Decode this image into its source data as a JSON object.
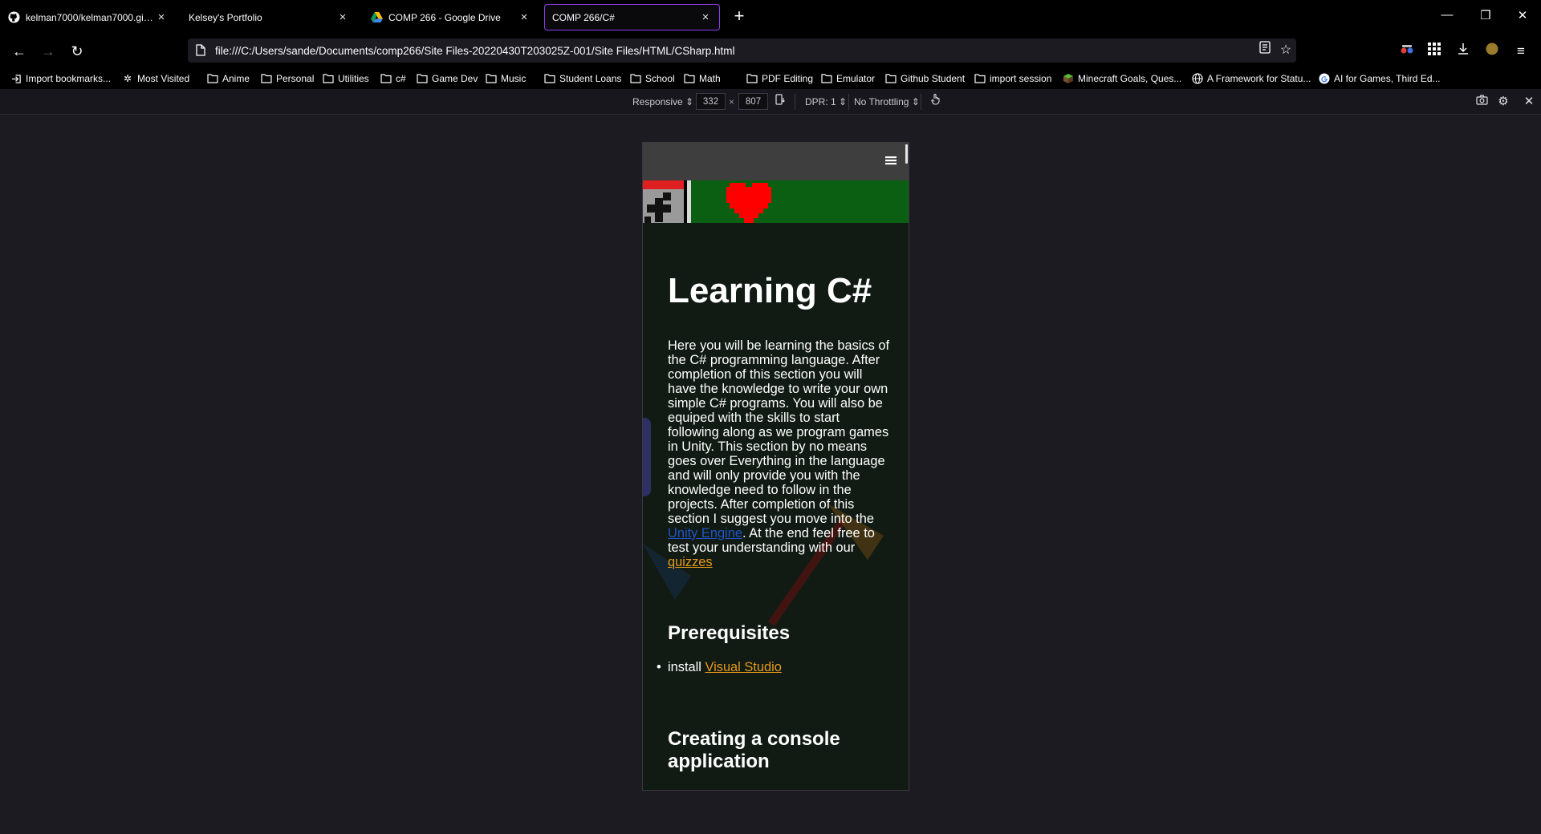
{
  "tabs": [
    {
      "title": "kelman7000/kelman7000.github.io",
      "icon": "github-icon",
      "active": false
    },
    {
      "title": "Kelsey's Portfolio",
      "icon": "",
      "active": false
    },
    {
      "title": "COMP 266 - Google Drive",
      "icon": "google-drive-icon",
      "active": false
    },
    {
      "title": "COMP 266/C#",
      "icon": "",
      "active": true
    }
  ],
  "window_controls": {
    "minimize": "—",
    "restore": "❐",
    "close": "✕"
  },
  "nav": {
    "back": "←",
    "forward": "→",
    "reload": "↻",
    "url": "file:///C:/Users/sande/Documents/comp266/Site Files-20220430T203025Z-001/Site Files/HTML/CSharp.html"
  },
  "bookmarks": [
    {
      "label": "Import bookmarks...",
      "icon": "import-icon"
    },
    {
      "label": "Most Visited",
      "icon": "gear-icon"
    },
    {
      "label": "Anime",
      "icon": "folder-icon"
    },
    {
      "label": "Personal",
      "icon": "folder-icon"
    },
    {
      "label": "Utilities",
      "icon": "folder-icon"
    },
    {
      "label": "c#",
      "icon": "folder-icon"
    },
    {
      "label": "Game Dev",
      "icon": "folder-icon"
    },
    {
      "label": "Music",
      "icon": "folder-icon"
    },
    {
      "label": "Student Loans",
      "icon": "folder-icon"
    },
    {
      "label": "School",
      "icon": "folder-icon"
    },
    {
      "label": "Math",
      "icon": "folder-icon"
    },
    {
      "label": "PDF Editing",
      "icon": "folder-icon"
    },
    {
      "label": "Emulator",
      "icon": "folder-icon"
    },
    {
      "label": "Github Student",
      "icon": "folder-icon"
    },
    {
      "label": "import session",
      "icon": "folder-icon"
    },
    {
      "label": "Minecraft Goals, Ques...",
      "icon": "minecraft-icon"
    },
    {
      "label": "A Framework for Statu...",
      "icon": "globe-icon"
    },
    {
      "label": "AI for Games, Third Ed...",
      "icon": "google-icon"
    }
  ],
  "rdm": {
    "device": "Responsive ⇕",
    "width": "332",
    "times": "×",
    "height": "807",
    "dpr": "DPR: 1 ⇕",
    "throttling": "No Throttling ⇕"
  },
  "site": {
    "heading": "Learning C#",
    "intro_text_1": "Here you will be learning the basics of the C# programming language. After completion of this section you will have the knowledge to write your own simple C# programs. You will also be equiped with the skills to start following along as we program games in Unity. This section by no means goes over Everything in the language and will only provide you with the knowledge need to follow in the projects. After completion of this section I suggest you move into the ",
    "unity_link": "Unity Engine",
    "intro_text_2": ". At the end feel free to test your understanding with our ",
    "quizzes_link": "quizzes",
    "prereq_heading": "Prerequisites",
    "prereq_install": "install ",
    "prereq_link": "Visual Studio",
    "console_heading": "Creating a console application"
  },
  "colors": {
    "accent": "#8c3fe8",
    "banner_green": "#0a5f12",
    "heart_red": "#ff0000",
    "link_blue": "#1f54c8",
    "link_orange": "#e69a1a"
  }
}
